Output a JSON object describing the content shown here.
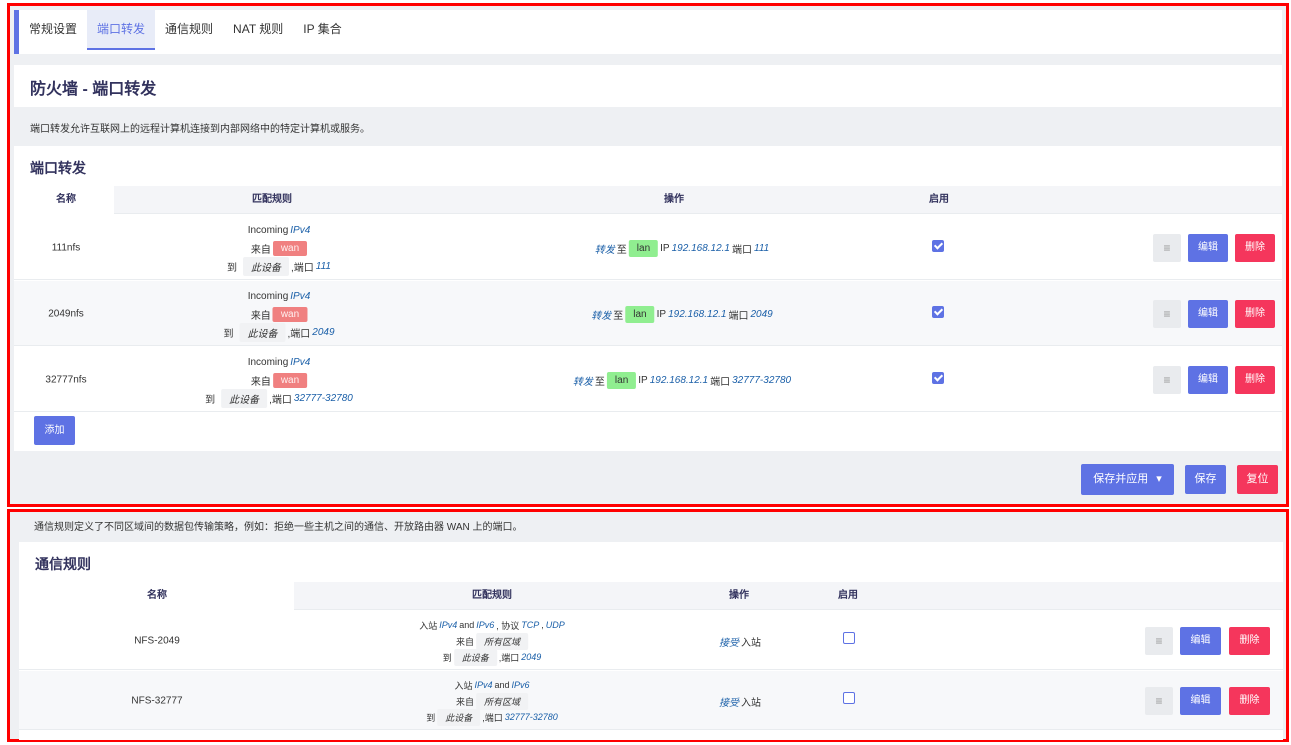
{
  "tabs": [
    "常规设置",
    "端口转发",
    "通信规则",
    "NAT 规则",
    "IP 集合"
  ],
  "page_title": "防火墙 - 端口转发",
  "page_description": "端口转发允许互联网上的远程计算机连接到内部网络中的特定计算机或服务。",
  "forwards": {
    "title": "端口转发",
    "headers": {
      "name": "名称",
      "match": "匹配规则",
      "action": "操作",
      "enable": "启用"
    },
    "rows": [
      {
        "name": "111nfs",
        "incoming": "Incoming",
        "family": "IPv4",
        "from_label": "来自",
        "from_zone": "wan",
        "to_label": "到",
        "to_zone": "此设备",
        "port_label": ",端口",
        "port": "111",
        "action": "转发",
        "to_word": "至",
        "dest_zone": "lan",
        "ip_label": "IP",
        "ip": "192.168.12.1",
        "dest_port_label": "端口",
        "dest_port": "111",
        "enabled": true
      },
      {
        "name": "2049nfs",
        "incoming": "Incoming",
        "family": "IPv4",
        "from_label": "来自",
        "from_zone": "wan",
        "to_label": "到",
        "to_zone": "此设备",
        "port_label": ",端口",
        "port": "2049",
        "action": "转发",
        "to_word": "至",
        "dest_zone": "lan",
        "ip_label": "IP",
        "ip": "192.168.12.1",
        "dest_port_label": "端口",
        "dest_port": "2049",
        "enabled": true
      },
      {
        "name": "32777nfs",
        "incoming": "Incoming",
        "family": "IPv4",
        "from_label": "来自",
        "from_zone": "wan",
        "to_label": "到",
        "to_zone": "此设备",
        "port_label": ",端口",
        "port": "32777-32780",
        "action": "转发",
        "to_word": "至",
        "dest_zone": "lan",
        "ip_label": "IP",
        "ip": "192.168.12.1",
        "dest_port_label": "端口",
        "dest_port": "32777-32780",
        "enabled": true
      }
    ],
    "drag_label": "≡",
    "edit_label": "编辑",
    "delete_label": "删除",
    "add_label": "添加"
  },
  "footer": {
    "save_apply_label": "保存并应用",
    "dropdown_caret": "▾",
    "save_label": "保存",
    "reset_label": "复位"
  },
  "rules_description": "通信规则定义了不同区域间的数据包传输策略，例如：拒绝一些主机之间的通信、开放路由器 WAN 上的端口。",
  "rules": {
    "title": "通信规则",
    "headers": {
      "name": "名称",
      "match": "匹配规则",
      "action": "操作",
      "enable": "启用"
    },
    "rows": [
      {
        "name": "NFS-2049",
        "in_label": "入站",
        "family1": "IPv4",
        "and_word": "and",
        "family2": "IPv6",
        "proto_label": ", 协议",
        "proto1": "TCP",
        "proto2": "UDP",
        "from_label": "来自",
        "from_zone": "所有区域",
        "to_label": "到",
        "to_zone": "此设备",
        "port_label": ",端口",
        "port": "2049",
        "action": "接受",
        "action_suffix": "入站",
        "enabled": false
      },
      {
        "name": "NFS-32777",
        "in_label": "入站",
        "family1": "IPv4",
        "and_word": "and",
        "family2": "IPv6",
        "from_label": "来自",
        "from_zone": "所有区域",
        "to_label": "到",
        "to_zone": "此设备",
        "port_label": ",端口",
        "port": "32777-32780",
        "action": "接受",
        "action_suffix": "入站",
        "enabled": false
      }
    ],
    "drag_label": "≡",
    "edit_label": "编辑",
    "delete_label": "删除"
  },
  "colors": {
    "accent": "#5e72e4",
    "danger": "#f5365c",
    "wan_zone": "#f08080",
    "lan_zone": "#90ee90",
    "highlight_border": "#ff0000"
  },
  "icons": {
    "drag": "drag-handle-icon",
    "caret": "chevron-down-icon",
    "check": "checkbox-check-icon"
  }
}
